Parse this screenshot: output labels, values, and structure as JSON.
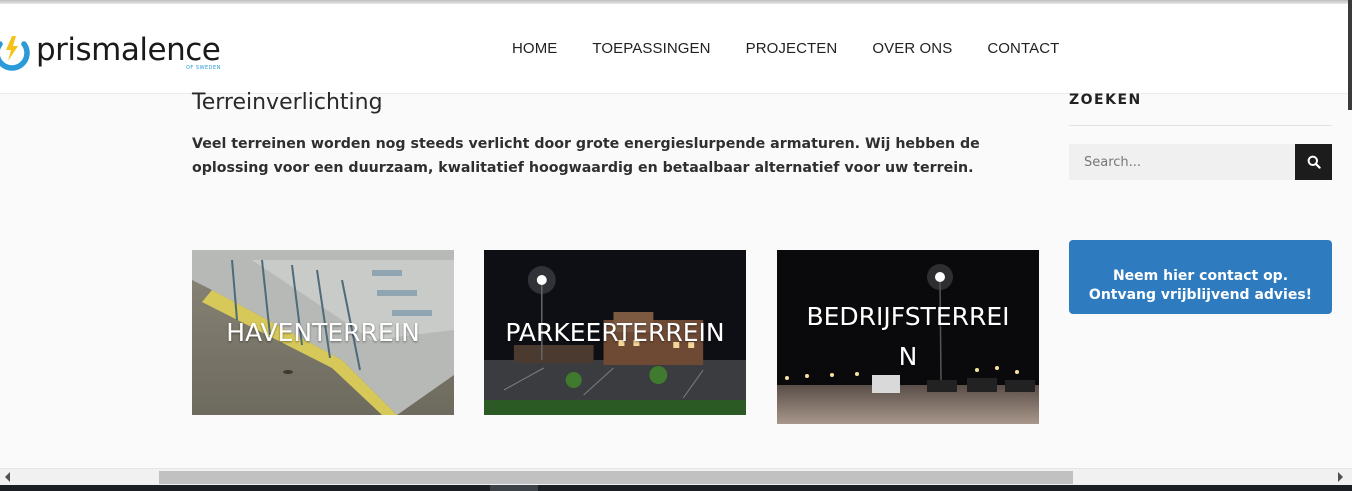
{
  "header": {
    "logo_text": "prismalence",
    "logo_sub": "OF SWEDEN",
    "nav": [
      {
        "label": "HOME"
      },
      {
        "label": "TOEPASSINGEN"
      },
      {
        "label": "PROJECTEN"
      },
      {
        "label": "OVER ONS"
      },
      {
        "label": "CONTACT"
      }
    ]
  },
  "main": {
    "title": "Terreinverlichting",
    "intro": "Veel terreinen worden nog steeds verlicht door grote energieslurpende armaturen. Wij hebben de oplossing voor een duurzaam, kwalitatief hoogwaardig en betaalbaar alternatief voor uw terrein.",
    "cards": [
      {
        "label": "HAVENTERREIN"
      },
      {
        "label": "PARKEERTERREIN"
      },
      {
        "label": "BEDRIJFSTERREIN"
      }
    ]
  },
  "sidebar": {
    "search_heading": "ZOEKEN",
    "search_placeholder": "Search...",
    "cta_line1": "Neem hier contact op.",
    "cta_line2": "Ontvang vrijblijvend advies!"
  },
  "colors": {
    "accent_blue": "#2f7bbf",
    "logo_blue": "#2a9ad8",
    "logo_yellow": "#f6c21a",
    "search_button": "#1c1c1c"
  },
  "icons": {
    "search": "magnifier-icon",
    "logo": "prism-logo-icon",
    "scroll_left": "arrow-left-icon",
    "scroll_right": "arrow-right-icon"
  }
}
